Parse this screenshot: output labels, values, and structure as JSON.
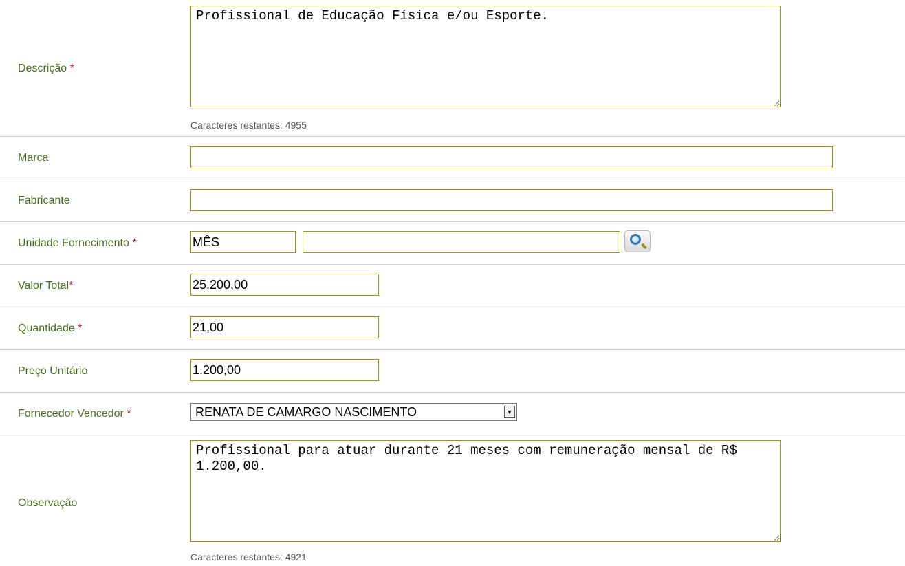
{
  "form": {
    "descricao": {
      "label": "Descrição",
      "required_mark": "*",
      "value": "Profissional de Educação Física e/ou Esporte.",
      "counter_label": "Caracteres restantes:",
      "counter_value": "4955"
    },
    "marca": {
      "label": "Marca",
      "value": ""
    },
    "fabricante": {
      "label": "Fabricante",
      "value": ""
    },
    "unidade": {
      "label": "Unidade Fornecimento",
      "required_mark": "*",
      "code": "MÊS",
      "description": "",
      "lookup_icon": "magnifier-icon"
    },
    "valor_total": {
      "label": "Valor Total",
      "required_mark": "*",
      "value": "25.200,00"
    },
    "quantidade": {
      "label": "Quantidade",
      "required_mark": "*",
      "value": "21,00"
    },
    "preco_unitario": {
      "label": "Preço Unitário",
      "value": "1.200,00"
    },
    "fornecedor": {
      "label": "Fornecedor Vencedor",
      "required_mark": "*",
      "selected": "RENATA DE CAMARGO NASCIMENTO"
    },
    "observacao": {
      "label": "Observação",
      "value": "Profissional para atuar durante 21 meses com remuneração mensal de R$ 1.200,00.",
      "counter_label": "Caracteres restantes:",
      "counter_value": "4921"
    }
  },
  "colors": {
    "label": "#4a6b1e",
    "required": "#d0101a",
    "field_border": "#999a00",
    "row_divider": "#cccccc"
  }
}
